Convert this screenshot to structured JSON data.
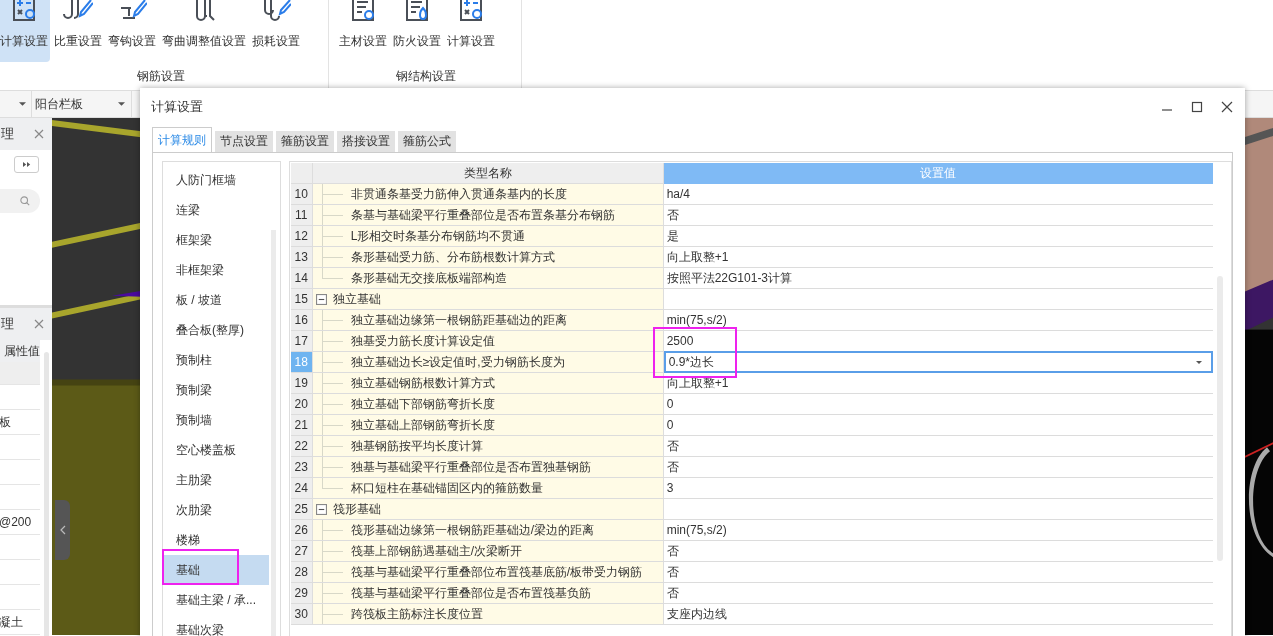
{
  "ribbon": {
    "groups": [
      {
        "label": "钢筋设置",
        "buttons": [
          {
            "label": "计算设置",
            "kind": "calc",
            "selected": true
          },
          {
            "label": "比重设置",
            "kind": "hook-pen",
            "selected": false
          },
          {
            "label": "弯钩设置",
            "kind": "bend-pen",
            "selected": false
          },
          {
            "label": "弯曲调整值设置",
            "kind": "u-bars",
            "selected": false
          },
          {
            "label": "损耗设置",
            "kind": "hooks-pen",
            "selected": false
          }
        ]
      },
      {
        "label": "钢结构设置",
        "buttons": [
          {
            "label": "主材设置",
            "kind": "doc-gear",
            "selected": false
          },
          {
            "label": "防火设置",
            "kind": "doc-fire",
            "selected": false
          },
          {
            "label": "计算设置",
            "kind": "calc",
            "selected": false
          }
        ]
      }
    ]
  },
  "toolbar": {
    "dropdown": "阳台栏板"
  },
  "left_panels": [
    {
      "title": "理"
    },
    {
      "title": "理",
      "column": "属性值",
      "cells": [
        "板",
        "@200",
        "凝土"
      ]
    }
  ],
  "dialog": {
    "title": "计算设置",
    "tabs": [
      {
        "label": "计算规则",
        "selected": true
      },
      {
        "label": "节点设置",
        "selected": false
      },
      {
        "label": "箍筋设置",
        "selected": false
      },
      {
        "label": "搭接设置",
        "selected": false
      },
      {
        "label": "箍筋公式",
        "selected": false
      }
    ],
    "categories": [
      {
        "label": "人防门框墙",
        "selected": false,
        "marked": false
      },
      {
        "label": "连梁",
        "selected": false,
        "marked": false
      },
      {
        "label": "框架梁",
        "selected": false,
        "marked": false
      },
      {
        "label": "非框架梁",
        "selected": false,
        "marked": false
      },
      {
        "label": "板 / 坡道",
        "selected": false,
        "marked": false
      },
      {
        "label": "叠合板(整厚)",
        "selected": false,
        "marked": false
      },
      {
        "label": "预制柱",
        "selected": false,
        "marked": false
      },
      {
        "label": "预制梁",
        "selected": false,
        "marked": false
      },
      {
        "label": "预制墙",
        "selected": false,
        "marked": false
      },
      {
        "label": "空心楼盖板",
        "selected": false,
        "marked": false
      },
      {
        "label": "主肋梁",
        "selected": false,
        "marked": false
      },
      {
        "label": "次肋梁",
        "selected": false,
        "marked": false
      },
      {
        "label": "楼梯",
        "selected": false,
        "marked": false
      },
      {
        "label": "基础",
        "selected": true,
        "marked": true
      },
      {
        "label": "基础主梁 / 承...",
        "selected": false,
        "marked": false
      },
      {
        "label": "基础次梁",
        "selected": false,
        "marked": false
      }
    ],
    "grid": {
      "columns": [
        "类型名称",
        "设置值"
      ],
      "rows": [
        {
          "num": "10",
          "kind": "item",
          "name": "非贯通条基受力筋伸入贯通条基内的长度",
          "value": "ha/4",
          "selected": false,
          "marked": false
        },
        {
          "num": "11",
          "kind": "item",
          "name": "条基与基础梁平行重叠部位是否布置条基分布钢筋",
          "value": "否",
          "selected": false,
          "marked": false
        },
        {
          "num": "12",
          "kind": "item",
          "name": "L形相交时条基分布钢筋均不贯通",
          "value": "是",
          "selected": false,
          "marked": false
        },
        {
          "num": "13",
          "kind": "item",
          "name": "条形基础受力筋、分布筋根数计算方式",
          "value": "向上取整+1",
          "selected": false,
          "marked": false
        },
        {
          "num": "14",
          "kind": "last",
          "name": "条形基础无交接底板端部构造",
          "value": "按照平法22G101-3计算",
          "selected": false,
          "marked": false
        },
        {
          "num": "15",
          "kind": "group",
          "name": "独立基础",
          "selected": false,
          "marked": false
        },
        {
          "num": "16",
          "kind": "item",
          "name": "独立基础边缘第一根钢筋距基础边的距离",
          "value": "min(75,s/2)",
          "selected": false,
          "marked": false
        },
        {
          "num": "17",
          "kind": "item",
          "name": "独基受力筋长度计算设定值",
          "value": "2500",
          "selected": false,
          "marked": true
        },
        {
          "num": "18",
          "kind": "item",
          "name": "独立基础边长≥设定值时,受力钢筋长度为",
          "value": "0.9*边长",
          "selected": true,
          "marked": true
        },
        {
          "num": "19",
          "kind": "item",
          "name": "独立基础钢筋根数计算方式",
          "value": "向上取整+1",
          "selected": false,
          "marked": false
        },
        {
          "num": "20",
          "kind": "item",
          "name": "独立基础下部钢筋弯折长度",
          "value": "0",
          "selected": false,
          "marked": false
        },
        {
          "num": "21",
          "kind": "item",
          "name": "独立基础上部钢筋弯折长度",
          "value": "0",
          "selected": false,
          "marked": false
        },
        {
          "num": "22",
          "kind": "item",
          "name": "独基钢筋按平均长度计算",
          "value": "否",
          "selected": false,
          "marked": false
        },
        {
          "num": "23",
          "kind": "item",
          "name": "独基与基础梁平行重叠部位是否布置独基钢筋",
          "value": "否",
          "selected": false,
          "marked": false
        },
        {
          "num": "24",
          "kind": "last",
          "name": "杯口短柱在基础锚固区内的箍筋数量",
          "value": "3",
          "selected": false,
          "marked": false
        },
        {
          "num": "25",
          "kind": "group",
          "name": "筏形基础",
          "selected": false,
          "marked": false
        },
        {
          "num": "26",
          "kind": "item",
          "name": "筏形基础边缘第一根钢筋距基础边/梁边的距离",
          "value": "min(75,s/2)",
          "selected": false,
          "marked": false
        },
        {
          "num": "27",
          "kind": "item",
          "name": "筏基上部钢筋遇基础主/次梁断开",
          "value": "否",
          "selected": false,
          "marked": false
        },
        {
          "num": "28",
          "kind": "item",
          "name": "筏基与基础梁平行重叠部位布置筏基底筋/板带受力钢筋",
          "value": "否",
          "selected": false,
          "marked": false
        },
        {
          "num": "29",
          "kind": "item",
          "name": "筏基与基础梁平行重叠部位是否布置筏基负筋",
          "value": "否",
          "selected": false,
          "marked": false
        },
        {
          "num": "30",
          "kind": "item",
          "name": "跨筏板主筋标注长度位置",
          "value": "支座内边线",
          "selected": false,
          "marked": false
        }
      ]
    }
  }
}
